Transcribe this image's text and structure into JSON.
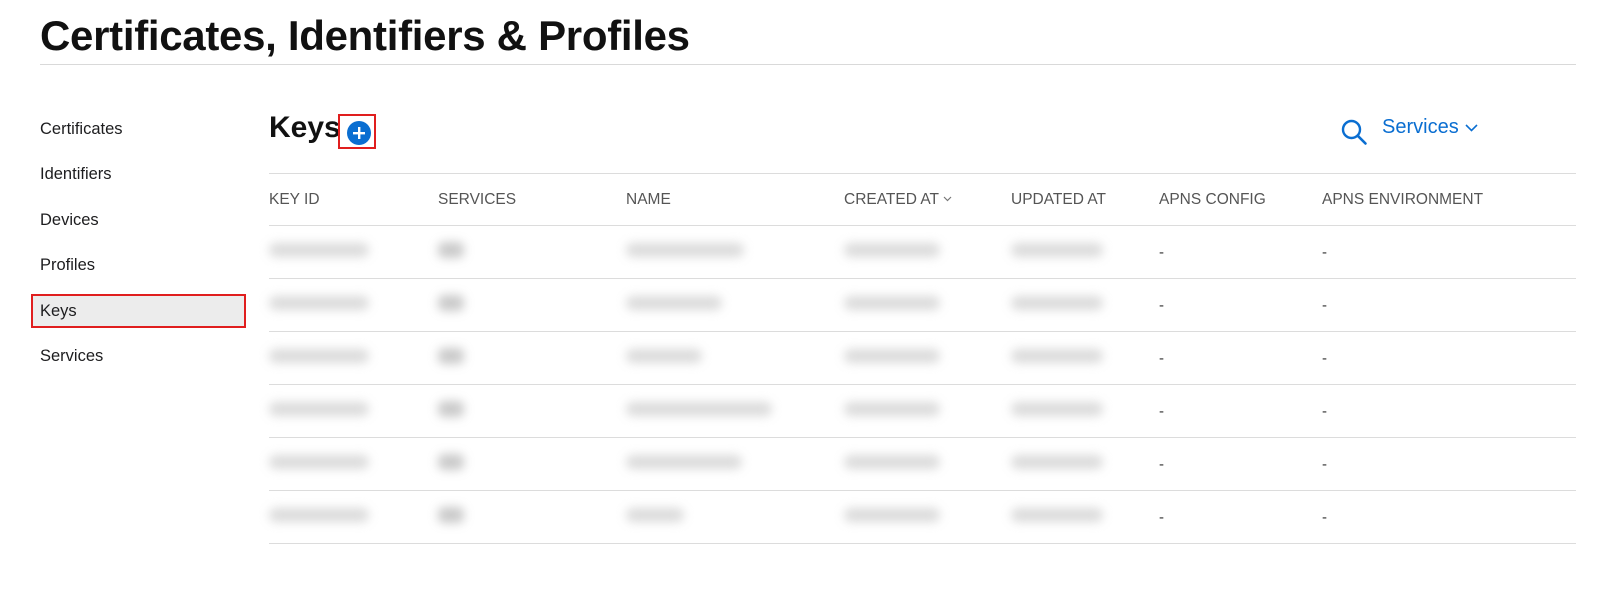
{
  "page_title": "Certificates, Identifiers & Profiles",
  "sidebar": {
    "items": [
      {
        "label": "Certificates"
      },
      {
        "label": "Identifiers"
      },
      {
        "label": "Devices"
      },
      {
        "label": "Profiles"
      },
      {
        "label": "Keys",
        "active": true
      },
      {
        "label": "Services"
      }
    ]
  },
  "section": {
    "title": "Keys",
    "filter_label": "Services"
  },
  "table": {
    "columns": [
      "KEY ID",
      "SERVICES",
      "NAME",
      "CREATED AT",
      "UPDATED AT",
      "APNS CONFIG",
      "APNS ENVIRONMENT"
    ],
    "sorted_column": "CREATED AT",
    "rows": [
      {
        "apns_config": "-",
        "apns_environment": "-"
      },
      {
        "apns_config": "-",
        "apns_environment": "-"
      },
      {
        "apns_config": "-",
        "apns_environment": "-"
      },
      {
        "apns_config": "-",
        "apns_environment": "-"
      },
      {
        "apns_config": "-",
        "apns_environment": "-"
      },
      {
        "apns_config": "-",
        "apns_environment": "-"
      }
    ]
  },
  "colors": {
    "accent": "#0a6ed1",
    "highlight_border": "#e01e1e",
    "active_bg": "#ececec"
  },
  "icons": [
    "plus-circle-icon",
    "search-icon",
    "chevron-down-icon",
    "sort-caret-icon"
  ]
}
